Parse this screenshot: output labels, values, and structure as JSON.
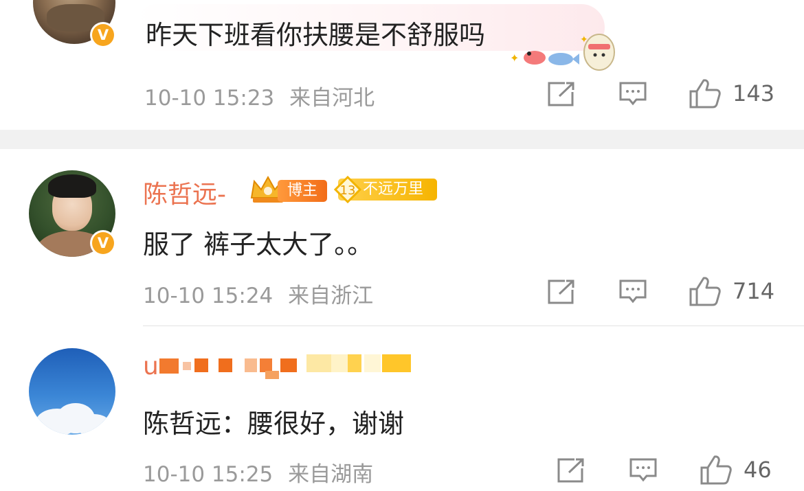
{
  "comments": [
    {
      "text": "昨天下班看你扶腰是不舒服吗",
      "time": "10-10 15:23",
      "location": "来自河北",
      "likes": "143",
      "avatar_icon": "avatar-photo",
      "verified_badge": "V"
    },
    {
      "username": "陈哲远-",
      "badge_bozhu": "博主",
      "badge_level_number": "13",
      "badge_level_text": "不远万里",
      "text": "服了 裤子太大了。。",
      "time": "10-10 15:24",
      "location": "来自浙江",
      "likes": "714",
      "verified_badge": "V"
    },
    {
      "username_partial": "u",
      "text": "陈哲远：腰很好，谢谢",
      "time": "10-10 15:25",
      "location": "来自湖南",
      "likes": "46"
    }
  ],
  "icons": [
    "repost-icon",
    "comment-icon",
    "like-icon"
  ],
  "colors": {
    "username": "#eb7350",
    "meta": "#9a9a9a",
    "verified": "#f7a51e",
    "separator": "#f1f1f1"
  }
}
